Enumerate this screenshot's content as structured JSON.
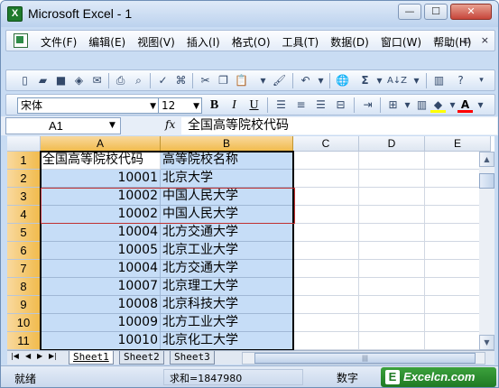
{
  "window": {
    "title": "Microsoft Excel - 1",
    "app_icon": "excel-icon",
    "controls": {
      "minimize": "—",
      "maximize": "☐",
      "close": "✕"
    }
  },
  "menubar": {
    "doc_icon": "workbook-icon",
    "items": [
      "文件(F)",
      "编辑(E)",
      "视图(V)",
      "插入(I)",
      "格式(O)",
      "工具(T)",
      "数据(D)",
      "窗口(W)",
      "帮助(H)"
    ],
    "right_controls": [
      "_",
      "▫",
      "×"
    ]
  },
  "toolbar_standard": {
    "icons": [
      "new-icon",
      "open-icon",
      "save-icon",
      "permission-icon",
      "email-icon",
      "print-icon",
      "print-preview-icon",
      "spelling-icon",
      "research-icon",
      "cut-icon",
      "copy-icon",
      "paste-icon",
      "format-painter-icon",
      "undo-icon",
      "insert-hyperlink-icon",
      "autosum-icon",
      "sort-ascending-icon",
      "chart-wizard-icon",
      "help-icon"
    ],
    "autosum_label": "Σ",
    "sort_label": "A↓Z"
  },
  "toolbar_format": {
    "font_name": "宋体",
    "font_size": "12",
    "bold": "B",
    "italic": "I",
    "underline": "U",
    "fill_color": "#ffff00",
    "font_color": "#ff0000"
  },
  "formulabar": {
    "name_box": "A1",
    "fx": "fx",
    "content": "全国高等院校代码"
  },
  "grid": {
    "columns": [
      "A",
      "B",
      "C",
      "D",
      "E"
    ],
    "rows": [
      {
        "num": "1",
        "a": "全国高等院校代码",
        "b": "高等院校名称"
      },
      {
        "num": "2",
        "a": "10001",
        "b": "北京大学"
      },
      {
        "num": "3",
        "a": "10002",
        "b": "中国人民大学"
      },
      {
        "num": "4",
        "a": "10002",
        "b": "中国人民大学"
      },
      {
        "num": "5",
        "a": "10004",
        "b": "北方交通大学"
      },
      {
        "num": "6",
        "a": "10005",
        "b": "北京工业大学"
      },
      {
        "num": "7",
        "a": "10004",
        "b": "北方交通大学"
      },
      {
        "num": "8",
        "a": "10007",
        "b": "北京理工大学"
      },
      {
        "num": "9",
        "a": "10008",
        "b": "北京科技大学"
      },
      {
        "num": "10",
        "a": "10009",
        "b": "北方工业大学"
      },
      {
        "num": "11",
        "a": "10010",
        "b": "北京化工大学"
      }
    ]
  },
  "sheets": {
    "tabs": [
      "Sheet1",
      "Sheet2",
      "Sheet3"
    ],
    "active": "Sheet1",
    "nav": [
      "|◀",
      "◀",
      "▶",
      "▶|"
    ]
  },
  "statusbar": {
    "ready": "就绪",
    "sum": "求和=1847980",
    "mode": "数字"
  },
  "watermark": {
    "logo": "E",
    "text": "Excelcn.com"
  }
}
